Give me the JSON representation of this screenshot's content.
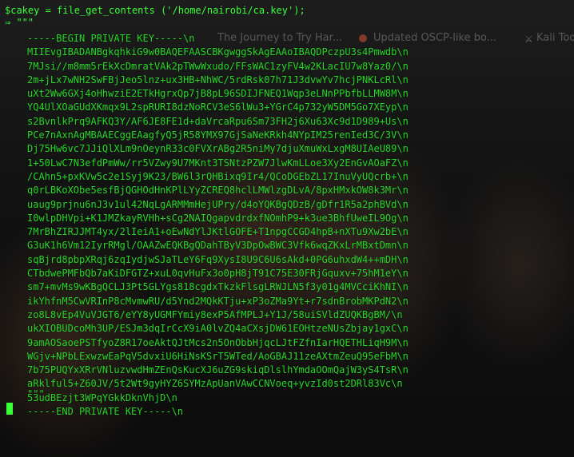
{
  "background_tabs": {
    "tab1": "The Journey to Try Har...",
    "tab2": "Updated OSCP-like bo...",
    "tab3": "Kali Tools"
  },
  "terminal": {
    "command": "$cakey = file_get_contents ('/home/nairobi/ca.key');",
    "result_arrow": "⇒ \"\"\"",
    "key_lines": [
      "-----BEGIN PRIVATE KEY-----\\n",
      "MIIEvgIBADANBgkqhkiG9w0BAQEFAASCBKgwggSkAgEAAoIBAQDPczpU3s4Pmwdb\\n",
      "7MJsi//m8mm5rEkXcDmratVAk2pTWwWxudo/FFsWAC1zyFV4w2KLacIU7w8Yaz0/\\n",
      "2m+jLx7wNH2SwFBjJeo5lnz+ux3HB+NhWC/5rdRsk07h71J3dvwYv7hcjPNKLcRl\\n",
      "uXt2Ww6GXj4oHhwziE2ETkHgrxQp7jB8pL96SDIJFNEQ1Wqp3eLNnPPbfbLLMW8M\\n",
      "YQ4UlXOaGUdXKmqx9L2spRURI8dzNoRCV3eS6lWu3+YGrC4p732yW5DM5Go7XEyp\\n",
      "s2BvnlkPrq9AFKQ3Y/AF6JE8FE1d+daVrcaRpu6Sm73FH2j6Xu63Xc9d1D989+Us\\n",
      "PCe7nAxnAgMBAAECggEAagfyQ5jR58YMX97GjSaNeKRkh4NYpIM25renIed3C/3V\\n",
      "Dj75Hw6vc7JJiQlXLm9nOeynR33c0FVXrABg2R5niMy7djuXmuWxLxgM8UIAeU89\\n",
      "1+50LwC7N3efdPmWw/rr5VZwy9U7MKnt3TSNtzPZW7JlwKmLLoe3Xy2EnGvAOaFZ\\n",
      "/CAhn5+pxKVw5c2e1Syj9K23/BW6l3rQHBixq9Ir4/QCoDGEbZL17InuVyUQcrb+\\n",
      "q0rLBKoXObe5esfBjQGHOdHnKPlLYyZCREQ8hclLMWlzgDLvA/8pxHMxkOW8k3Mr\\n",
      "uaug9prjnu6nJ3v1ul42NqLgARMMmHejUPry/d4oYQKBgQDzB/gDfr1R5a2phBVd\\n",
      "I0wlpDHVpi+K1JMZkayRVHh+sCg2NAIQgapvdrdxfNOmhP9+k3ue3BhfUweIL9Og\\n",
      "7MrBhZIRJJMT4yx/2lIeiA1+oEwNdYlJKtlGOFE+T1npgCCGD4hpB+nXTu9Xw2bE\\n",
      "G3uK1h6Vm12IyrRMgl/OAAZwEQKBgQDahTByV3DpOwBWC3Vfk6wqZKxLrMBxtDmn\\n",
      "sqBjrd8pbpXRqj6zqIydjwSJaTLeY6Fq9XysI8U9C6U6sAkd+0PG6uhxdW4++mDH\\n",
      "CTbdwePMFbQb7aKiDFGTZ+xuL0qvHuFx3o0pH8jT91C75E30FRjGquxv+75hM1eY\\n",
      "sm7+mvMs9wKBgQCLJ3Pt5GLYgs818cgdxTkzkFlsgLRWJLN5f3y01g4MVCciKhNI\\n",
      "ikYhfnM5CwVRInP8cMvmwRU/d5Ynd2MQkKTju+xP3oZMa9Yt+r7sdnBrobMKPdN2\\n",
      "zo8L8vEp4VuVJGT6/eYY8yUGMFYmiy8exP5AfMPLJ+Y1J/58uiSVldZUQKBgBM/\\n",
      "ukXIOBUDcoMh3UP/ESJm3dqIrCcX9iA0lvZQ4aCXsjDW61EOHtzeNUsZbjay1gxC\\n",
      "9amAOSaoePSTfyoZ8R17oeAktQJtMcs2n5OnObbHjqcLJtFZfnIarHQETHLiqH9M\\n",
      "WGjv+NPbLExwzwEaPqV5dvxiU6HiNsKSrT5WTed/AoGBAJ11zeAXtmZeuQ95eFbM\\n",
      "7b75PUQYxXRrVNluzvwdHmZEnQsKucXJ6uZG9skiqDlslhYmdaOOmQajW3yS4TsR\\n",
      "aRklful5+Z60JV/5t2Wt9gyHYZ6SYMzApUanVAwCCNVoeq+yvzId0st2DRl83Vc\\n",
      "53udBEzjt3WPqYGkkDknVhjD\\n",
      "-----END PRIVATE KEY-----\\n"
    ],
    "close_quotes": "\"\"\""
  }
}
